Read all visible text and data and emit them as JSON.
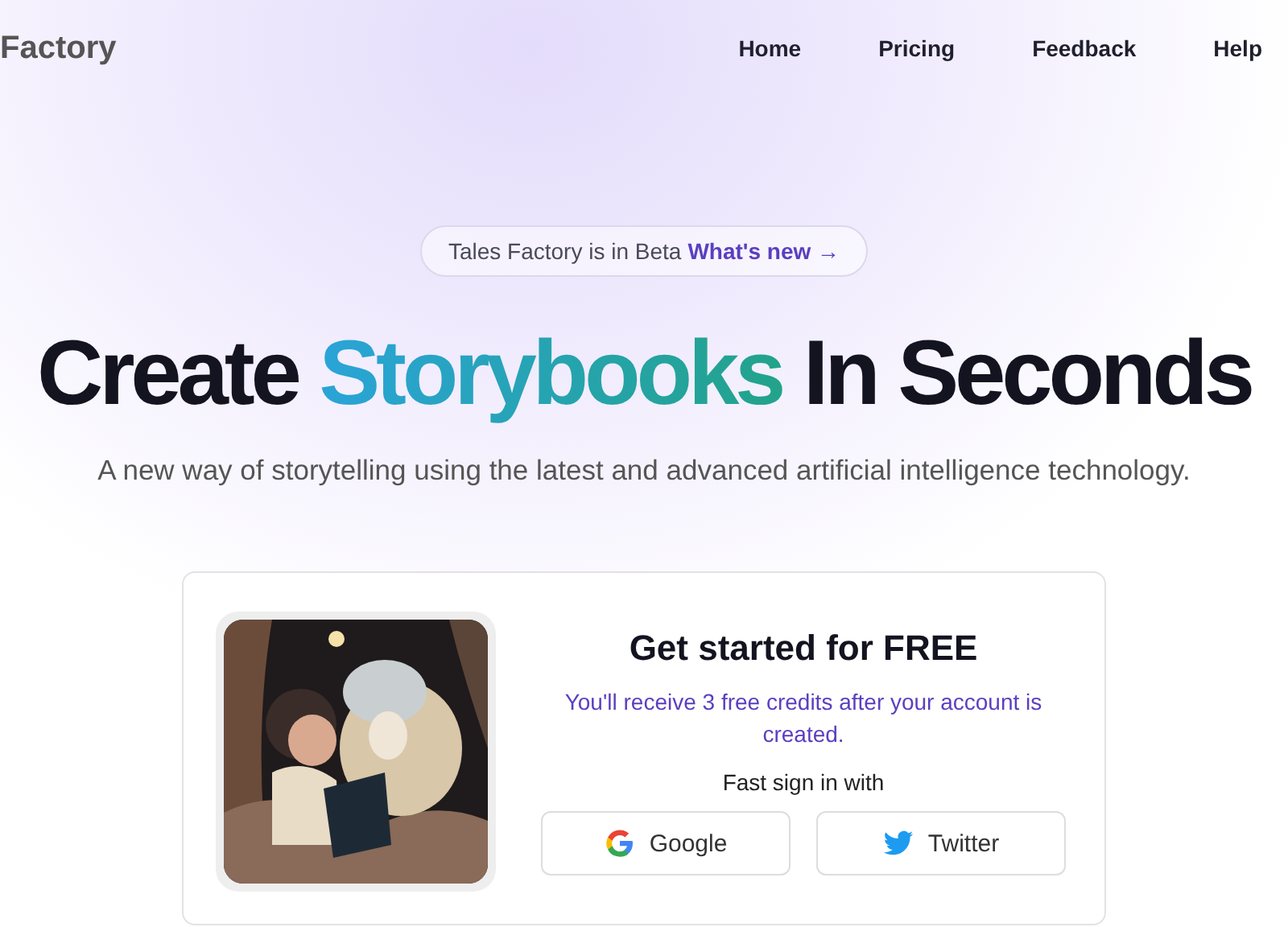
{
  "brand": "Factory",
  "nav": [
    {
      "label": "Home"
    },
    {
      "label": "Pricing"
    },
    {
      "label": "Feedback"
    },
    {
      "label": "Help"
    }
  ],
  "announcement": {
    "text": "Tales Factory is in Beta",
    "link": "What's new →"
  },
  "headline": [
    {
      "text": "Create",
      "highlight": false
    },
    {
      "text": "Storybooks",
      "highlight": true
    },
    {
      "text": "In Seconds",
      "highlight": false
    }
  ],
  "subtitle": "A new way of storytelling using the latest and advanced artificial intelligence technology.",
  "signup": {
    "title": "Get started for FREE",
    "note": "You'll receive 3 free credits after your account is created.",
    "prompt": "Fast sign in with",
    "buttons": [
      {
        "kind": "google",
        "label": "Google"
      },
      {
        "kind": "twitter",
        "label": "Twitter"
      }
    ]
  }
}
